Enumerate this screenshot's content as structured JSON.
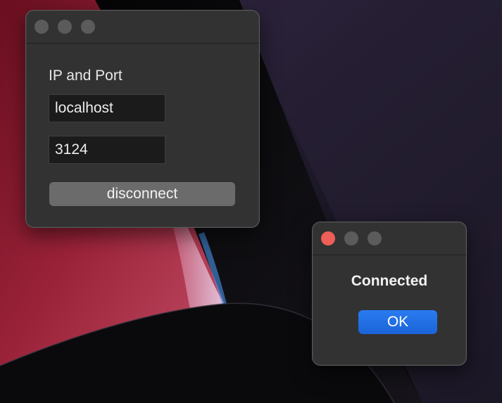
{
  "main_window": {
    "section_label": "IP and Port",
    "ip_field_value": "localhost",
    "port_field_value": "3124",
    "disconnect_label": "disconnect"
  },
  "alert_window": {
    "message": "Connected",
    "ok_label": "OK"
  },
  "colors": {
    "window_bg": "#323232",
    "field_bg": "#1b1b1b",
    "gray_button": "#6b6b6b",
    "primary_button": "#1f6fe5",
    "close_button_active": "#ee5f57",
    "traffic_inactive": "#5b5b5b"
  }
}
